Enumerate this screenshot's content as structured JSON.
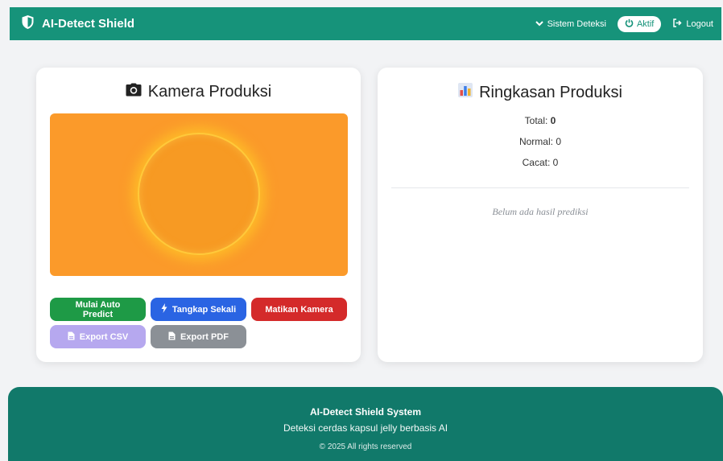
{
  "navbar": {
    "brand": "AI-Detect Shield",
    "menu_label": "Sistem Deteksi",
    "status_label": "Aktif",
    "logout_label": "Logout"
  },
  "camera_card": {
    "title": "Kamera Produksi",
    "buttons": {
      "auto_predict": "Mulai Auto Predict",
      "capture_once": "Tangkap Sekali",
      "stop_camera": "Matikan Kamera",
      "export_csv": "Export CSV",
      "export_pdf": "Export PDF"
    }
  },
  "summary_card": {
    "title": "Ringkasan Produksi",
    "total_label": "Total:",
    "total_value": "0",
    "normal_label": "Normal:",
    "normal_value": "0",
    "defect_label": "Cacat:",
    "defect_value": "0",
    "empty_message": "Belum ada hasil prediksi"
  },
  "footer": {
    "title": "AI-Detect Shield System",
    "tagline": "Deteksi cerdas kapsul jelly berbasis AI",
    "copyright": "© 2025 All rights reserved"
  },
  "colors": {
    "primary": "#16937a",
    "footer": "#11796a",
    "camera_bg": "#fb9a2a",
    "green": "#1e9a46",
    "blue": "#2a64e3",
    "red": "#d42a2a",
    "purple": "#b6a8ef",
    "gray": "#8b9096"
  },
  "icons": {
    "brand": "shield-icon",
    "menu": "chevron-down-icon",
    "status": "power-icon",
    "logout": "logout-icon",
    "camera": "camera-icon",
    "summary": "bar-chart-icon",
    "capture": "lightning-icon",
    "export": "file-icon"
  }
}
